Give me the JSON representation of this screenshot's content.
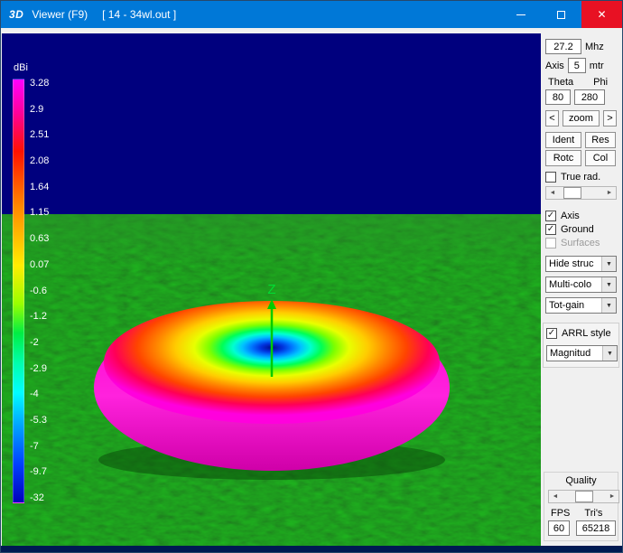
{
  "window": {
    "icon": "3D",
    "title": "Viewer (F9)",
    "subtitle": "[ 14 - 34wl.out ]",
    "controls": {
      "close": "✕"
    }
  },
  "colors": {
    "titlebar": "#0078d7",
    "sky": "#00007e",
    "ground": "#157315",
    "close": "#e81123",
    "panel": "#f0f0f0"
  },
  "legend": {
    "unit": "dBi",
    "values": [
      "3.28",
      "2.9",
      "2.51",
      "2.08",
      "1.64",
      "1.15",
      "0.63",
      "0.07",
      "-0.6",
      "-1.2",
      "-2",
      "-2.9",
      "-4",
      "-5.3",
      "-7",
      "-9.7",
      "-32"
    ]
  },
  "scene": {
    "z_axis_label": "Z"
  },
  "panel": {
    "freq_value": "27.2",
    "freq_unit": "Mhz",
    "axis_label": "Axis",
    "axis_value": "5",
    "axis_unit": "mtr",
    "theta_label": "Theta",
    "phi_label": "Phi",
    "theta_value": "80",
    "phi_value": "280",
    "zoom_prev": "<",
    "zoom_label": "zoom",
    "zoom_next": ">",
    "btn_ident": "Ident",
    "btn_res": "Res",
    "btn_rotc": "Rotc",
    "btn_col": "Col",
    "true_rad": {
      "label": "True rad.",
      "mark": ""
    },
    "checks": [
      {
        "label": "Axis",
        "mark": "✓"
      },
      {
        "label": "Ground",
        "mark": "✓"
      },
      {
        "label": "Surfaces",
        "mark": ""
      }
    ],
    "dd_structure": "Hide struc",
    "dd_color": "Multi-colo",
    "dd_gain": "Tot-gain",
    "arrl": {
      "label": "ARRL style",
      "mark": "✓"
    },
    "dd_style": "Magnitud",
    "quality": {
      "title": "Quality",
      "fps_label": "FPS",
      "tris_label": "Tri's",
      "fps_value": "60",
      "tris_value": "65218"
    },
    "icons": {
      "dropdown": "▼",
      "scroll_left": "◄",
      "scroll_right": "►"
    }
  }
}
